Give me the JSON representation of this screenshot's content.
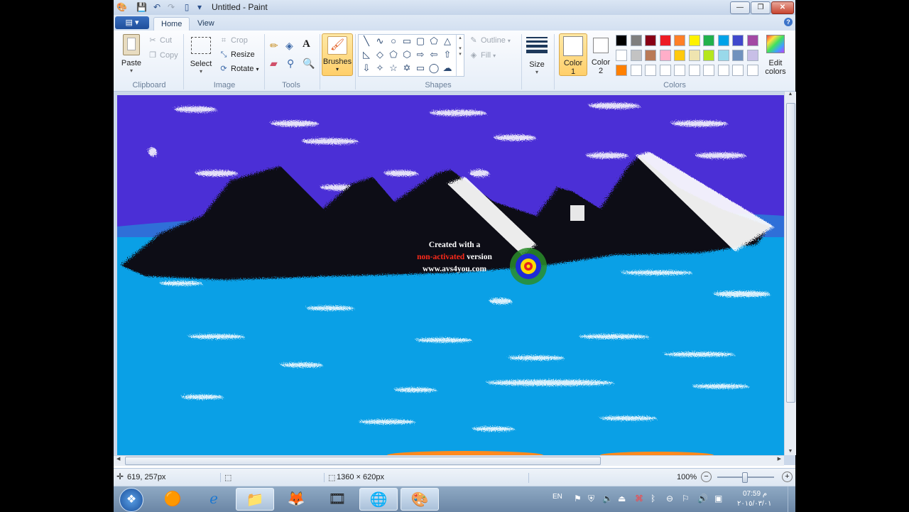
{
  "window": {
    "title": "Untitled - Paint",
    "controls": {
      "minimize": "—",
      "maximize": "❐",
      "close": "✕"
    }
  },
  "menu": {
    "file_label": "▤ ▾",
    "tabs": [
      {
        "label": "Home",
        "active": true
      },
      {
        "label": "View",
        "active": false
      }
    ],
    "help": "?"
  },
  "ribbon": {
    "clipboard": {
      "label": "Clipboard",
      "paste": "Paste",
      "cut": "Cut",
      "copy": "Copy"
    },
    "image": {
      "label": "Image",
      "select": "Select",
      "crop": "Crop",
      "resize": "Resize",
      "rotate": "Rotate"
    },
    "tools": {
      "label": "Tools"
    },
    "brushes": {
      "label": "Brushes"
    },
    "shapes": {
      "label": "Shapes",
      "outline": "Outline",
      "fill": "Fill"
    },
    "size": {
      "label": "Size"
    },
    "color1": {
      "label1": "Color",
      "label2": "1"
    },
    "color2": {
      "label1": "Color",
      "label2": "2"
    },
    "colors": {
      "label": "Colors",
      "edit_label1": "Edit",
      "edit_label2": "colors",
      "row1": [
        "#000000",
        "#7f7f7f",
        "#880015",
        "#ed1c24",
        "#ff7f27",
        "#fff200",
        "#22b14c",
        "#00a2e8",
        "#3f48cc",
        "#a349a4"
      ],
      "row2": [
        "#ffffff",
        "#c3c3c3",
        "#b97a57",
        "#ffaec9",
        "#ffc90e",
        "#efe4b0",
        "#b5e61d",
        "#99d9ea",
        "#7092be",
        "#c8bfe7"
      ],
      "row3": [
        "#ff8000",
        "#ffffff",
        "#ffffff",
        "#ffffff",
        "#ffffff",
        "#ffffff",
        "#ffffff",
        "#ffffff",
        "#ffffff",
        "#ffffff"
      ]
    }
  },
  "watermark": {
    "line1": "Created with a",
    "line2_red": "non-activated",
    "line2_rest": " version",
    "line3": "www.avs4you.com"
  },
  "status": {
    "cursor_pos": "619, 257px",
    "image_size": "1360 × 620px",
    "zoom": "100%"
  },
  "taskbar": {
    "lang": "EN",
    "time": "07:59 م",
    "date": "٢٠١٥/٠٣/٠١"
  }
}
